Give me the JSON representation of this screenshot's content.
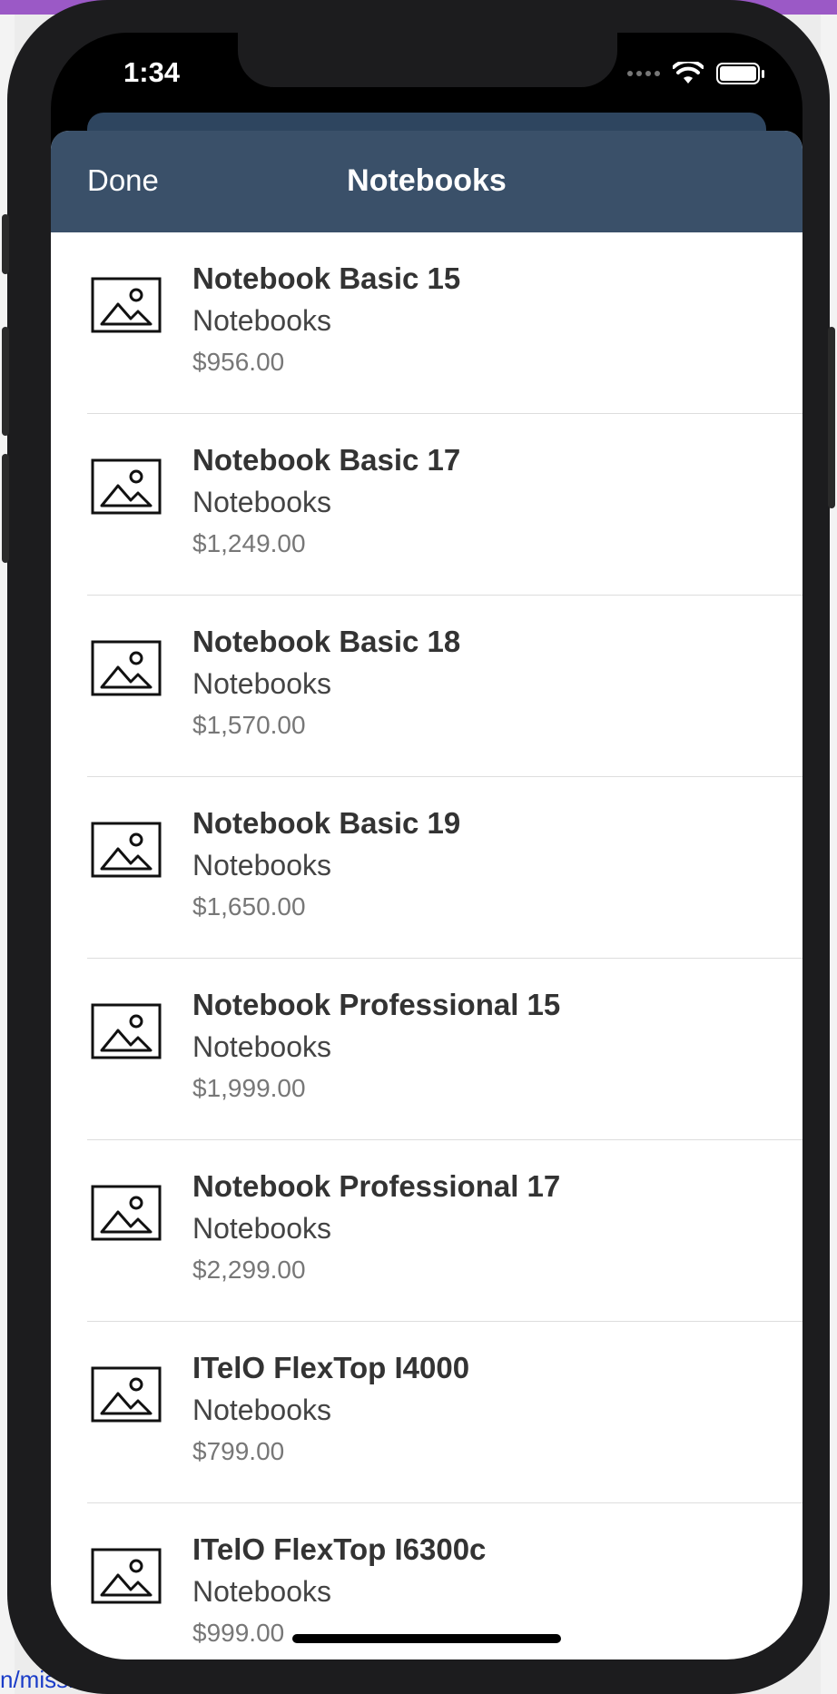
{
  "status_bar": {
    "time": "1:34"
  },
  "nav": {
    "done_label": "Done",
    "title": "Notebooks"
  },
  "products": [
    {
      "name": "Notebook Basic 15",
      "category": "Notebooks",
      "price": "$956.00"
    },
    {
      "name": "Notebook Basic 17",
      "category": "Notebooks",
      "price": "$1,249.00"
    },
    {
      "name": "Notebook Basic 18",
      "category": "Notebooks",
      "price": "$1,570.00"
    },
    {
      "name": "Notebook Basic 19",
      "category": "Notebooks",
      "price": "$1,650.00"
    },
    {
      "name": "Notebook Professional 15",
      "category": "Notebooks",
      "price": "$1,999.00"
    },
    {
      "name": "Notebook Professional 17",
      "category": "Notebooks",
      "price": "$2,299.00"
    },
    {
      "name": "ITelO FlexTop I4000",
      "category": "Notebooks",
      "price": "$799.00"
    },
    {
      "name": "ITelO FlexTop I6300c",
      "category": "Notebooks",
      "price": "$999.00"
    }
  ],
  "background": {
    "url_fragment": "n/missi"
  },
  "colors": {
    "nav_bar": "#3a5069",
    "nav_text": "#ffffff",
    "background_accent": "#9b59c6"
  },
  "icons": {
    "product_thumbnail": "image-placeholder-icon"
  }
}
